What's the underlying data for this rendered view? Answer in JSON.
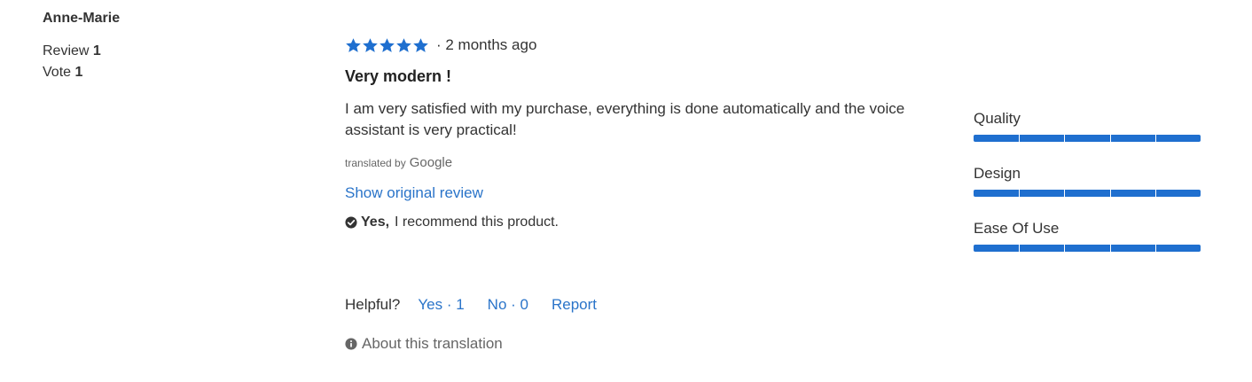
{
  "reviewer": {
    "name": "Anne-Marie",
    "review_label": "Review",
    "review_count": "1",
    "vote_label": "Vote",
    "vote_count": "1"
  },
  "review": {
    "rating": 5,
    "rating_max": 5,
    "star_color": "#1f6fcf",
    "date": "· 2 months ago",
    "title": "Very modern !",
    "body": "I am very satisfied with my purchase, everything is done automatically and the voice assistant is very practical!",
    "translated_by": "translated by",
    "google": "Google",
    "show_original": "Show original review",
    "recommend_yes": "Yes,",
    "recommend_text": "I recommend this product."
  },
  "feedback": {
    "helpful_label": "Helpful?",
    "yes_label": "Yes · 1",
    "no_label": "No · 0",
    "report_label": "Report"
  },
  "about_translation": "About this translation",
  "secondary_ratings": [
    {
      "label": "Quality",
      "value": 5,
      "max": 5
    },
    {
      "label": "Design",
      "value": 5,
      "max": 5
    },
    {
      "label": "Ease Of Use",
      "value": 5,
      "max": 5
    }
  ],
  "colors": {
    "link": "#2a74c9",
    "bar_fill": "#1f6fcf"
  }
}
